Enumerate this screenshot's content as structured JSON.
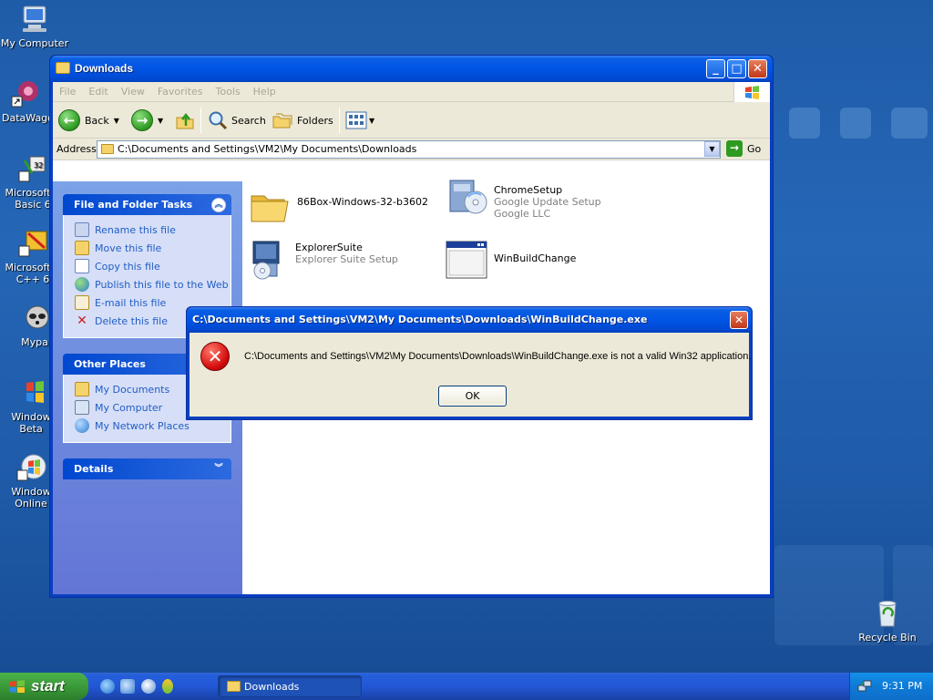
{
  "desktop": {
    "icons": [
      {
        "label": "My Computer"
      },
      {
        "label": "DataWago"
      },
      {
        "label": "Microsoft V\nBasic 6"
      },
      {
        "label": "Microsoft V\nC++ 6"
      },
      {
        "label": "Mypa"
      },
      {
        "label": "Window\nBeta"
      },
      {
        "label": "Window\nOnline"
      },
      {
        "label": "Recycle Bin"
      }
    ]
  },
  "explorer": {
    "title": "Downloads",
    "menu": [
      "File",
      "Edit",
      "View",
      "Favorites",
      "Tools",
      "Help"
    ],
    "toolbar": {
      "back": "Back",
      "search": "Search",
      "folders": "Folders"
    },
    "address": {
      "label": "Address",
      "value": "C:\\Documents and Settings\\VM2\\My Documents\\Downloads",
      "go": "Go"
    },
    "taskpane": {
      "file_tasks": {
        "title": "File and Folder Tasks",
        "items": [
          "Rename this file",
          "Move this file",
          "Copy this file",
          "Publish this file to the Web",
          "E-mail this file",
          "Delete this file"
        ]
      },
      "other_places": {
        "title": "Other Places",
        "items": [
          "My Documents",
          "My Computer",
          "My Network Places"
        ]
      },
      "details": {
        "title": "Details"
      }
    },
    "files": [
      {
        "name": "86Box-Windows-32-b3602",
        "line2": "",
        "line3": ""
      },
      {
        "name": "ChromeSetup",
        "line2": "Google Update Setup",
        "line3": "Google LLC"
      },
      {
        "name": "ExplorerSuite",
        "line2": "Explorer Suite Setup",
        "line3": ""
      },
      {
        "name": "WinBuildChange",
        "line2": "",
        "line3": ""
      }
    ]
  },
  "dialog": {
    "title": "C:\\Documents and Settings\\VM2\\My Documents\\Downloads\\WinBuildChange.exe",
    "message": "C:\\Documents and Settings\\VM2\\My Documents\\Downloads\\WinBuildChange.exe is not a valid Win32 application.",
    "ok": "OK"
  },
  "taskbar": {
    "start": "start",
    "task": "Downloads",
    "clock": "9:31 PM"
  }
}
